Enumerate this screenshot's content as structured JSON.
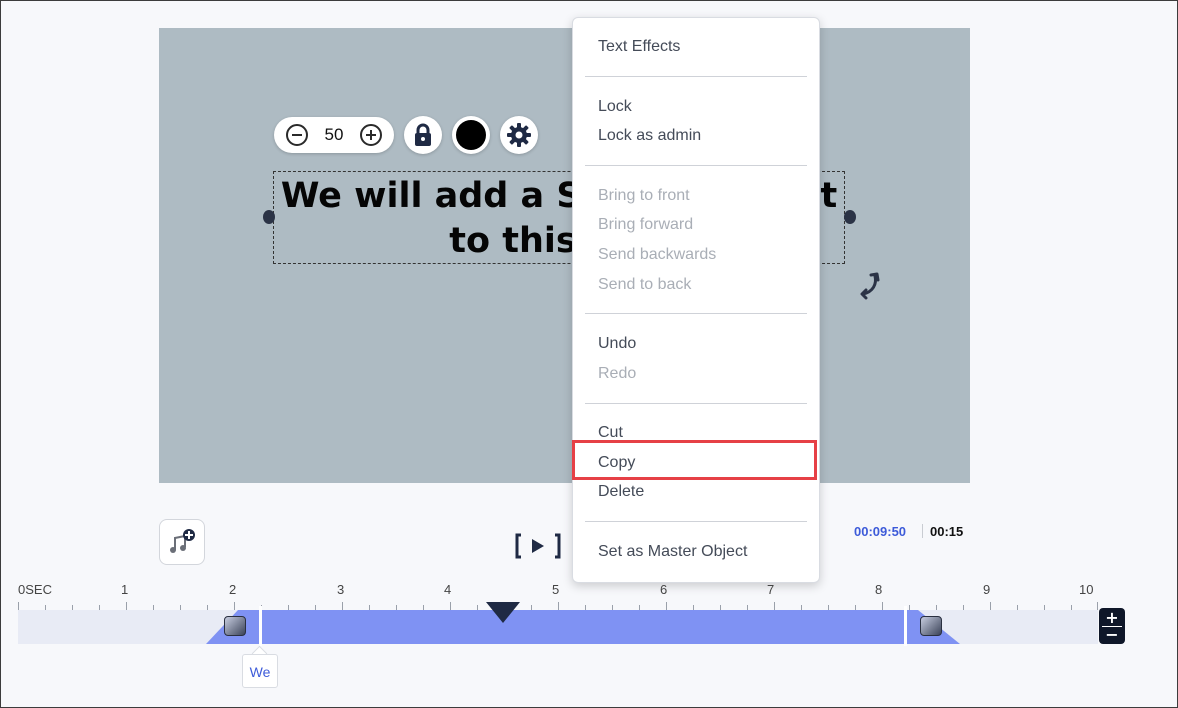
{
  "editor": {
    "zoom_value": "50",
    "text_content_line1": "We will add a Shadow Effect",
    "text_content_line2": "to this text",
    "text_color": "#000000"
  },
  "context_menu": {
    "items": [
      {
        "label": "Text Effects",
        "enabled": true
      },
      {
        "label": "Lock",
        "enabled": true
      },
      {
        "label": "Lock as admin",
        "enabled": true
      },
      {
        "label": "Bring to front",
        "enabled": false
      },
      {
        "label": "Bring forward",
        "enabled": false
      },
      {
        "label": "Send backwards",
        "enabled": false
      },
      {
        "label": "Send to back",
        "enabled": false
      },
      {
        "label": "Undo",
        "enabled": true
      },
      {
        "label": "Redo",
        "enabled": false
      },
      {
        "label": "Cut",
        "enabled": true
      },
      {
        "label": "Copy",
        "enabled": true,
        "highlighted": true
      },
      {
        "label": "Delete",
        "enabled": true
      },
      {
        "label": "Set as Master Object",
        "enabled": true
      }
    ]
  },
  "playback": {
    "current_time": "00:09:50",
    "total_time": "00:15"
  },
  "timeline": {
    "ticks": [
      "0SEC",
      "1",
      "2",
      "3",
      "4",
      "5",
      "6",
      "7",
      "8",
      "9",
      "10"
    ],
    "clip_label": "We",
    "zoom_in": "+",
    "zoom_out": "−"
  },
  "colors": {
    "canvas_bg": "#aebbc3",
    "clip_fill": "#7f92f3",
    "accent_blue": "#3d5bd9",
    "highlight_red": "#e64046",
    "dark_navy": "#1f2a44"
  }
}
